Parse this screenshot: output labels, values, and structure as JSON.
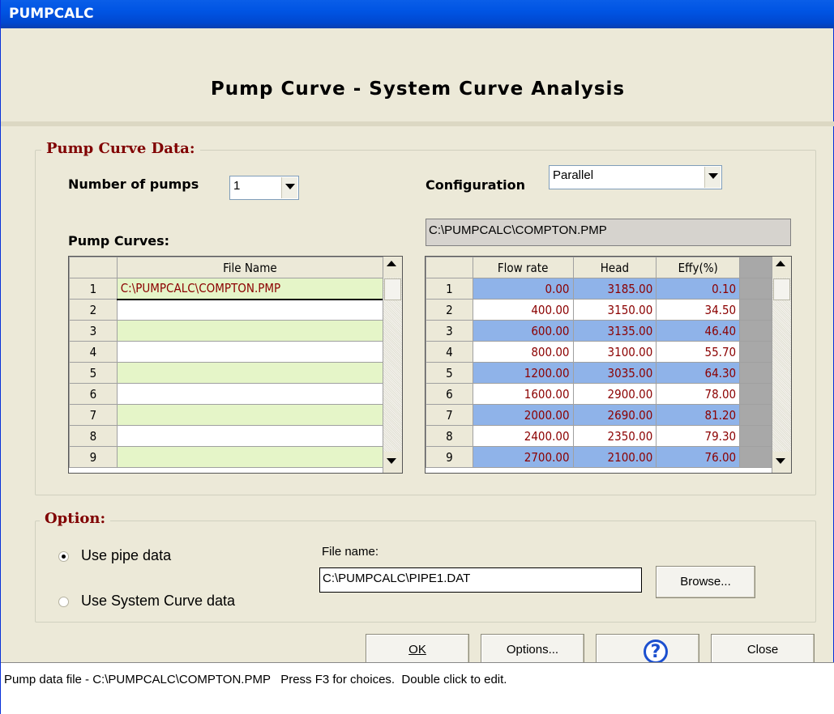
{
  "window": {
    "title": "PUMPCALC"
  },
  "heading": "Pump Curve - System Curve Analysis",
  "pump_group": {
    "legend": "Pump Curve Data:",
    "num_pumps_label": "Number of pumps",
    "num_pumps_value": "1",
    "configuration_label": "Configuration",
    "configuration_value": "Parallel",
    "pump_curves_label": "Pump Curves:",
    "current_file": "C:\\PUMPCALC\\COMPTON.PMP",
    "files_header": "File Name",
    "files": [
      {
        "row": "1",
        "name": "C:\\PUMPCALC\\COMPTON.PMP"
      },
      {
        "row": "2",
        "name": ""
      },
      {
        "row": "3",
        "name": ""
      },
      {
        "row": "4",
        "name": ""
      },
      {
        "row": "5",
        "name": ""
      },
      {
        "row": "6",
        "name": ""
      },
      {
        "row": "7",
        "name": ""
      },
      {
        "row": "8",
        "name": ""
      },
      {
        "row": "9",
        "name": ""
      }
    ],
    "data_headers": {
      "flow": "Flow rate",
      "head": "Head",
      "effy": "Effy(%)"
    },
    "data_rows": [
      {
        "row": "1",
        "flow": "0.00",
        "head": "3185.00",
        "effy": "0.10"
      },
      {
        "row": "2",
        "flow": "400.00",
        "head": "3150.00",
        "effy": "34.50"
      },
      {
        "row": "3",
        "flow": "600.00",
        "head": "3135.00",
        "effy": "46.40"
      },
      {
        "row": "4",
        "flow": "800.00",
        "head": "3100.00",
        "effy": "55.70"
      },
      {
        "row": "5",
        "flow": "1200.00",
        "head": "3035.00",
        "effy": "64.30"
      },
      {
        "row": "6",
        "flow": "1600.00",
        "head": "2900.00",
        "effy": "78.00"
      },
      {
        "row": "7",
        "flow": "2000.00",
        "head": "2690.00",
        "effy": "81.20"
      },
      {
        "row": "8",
        "flow": "2400.00",
        "head": "2350.00",
        "effy": "79.30"
      },
      {
        "row": "9",
        "flow": "2700.00",
        "head": "2100.00",
        "effy": "76.00"
      }
    ]
  },
  "option_group": {
    "legend": "Option:",
    "use_pipe_label": "Use pipe data",
    "use_system_label": "Use System Curve data",
    "selected": "pipe",
    "file_name_label": "File name:",
    "file_name_value": "C:\\PUMPCALC\\PIPE1.DAT",
    "browse_label": "Browse..."
  },
  "buttons": {
    "ok": "OK",
    "options": "Options...",
    "help": "?",
    "close": "Close"
  },
  "status_text": "Pump data file - C:\\PUMPCALC\\COMPTON.PMP   Press F3 for choices.  Double click to edit.",
  "colors": {
    "title_bar": "#0054e3",
    "legend_text": "#800000",
    "alt_row_blue": "#8fb3e9",
    "alt_row_green": "#e5f5c8"
  }
}
